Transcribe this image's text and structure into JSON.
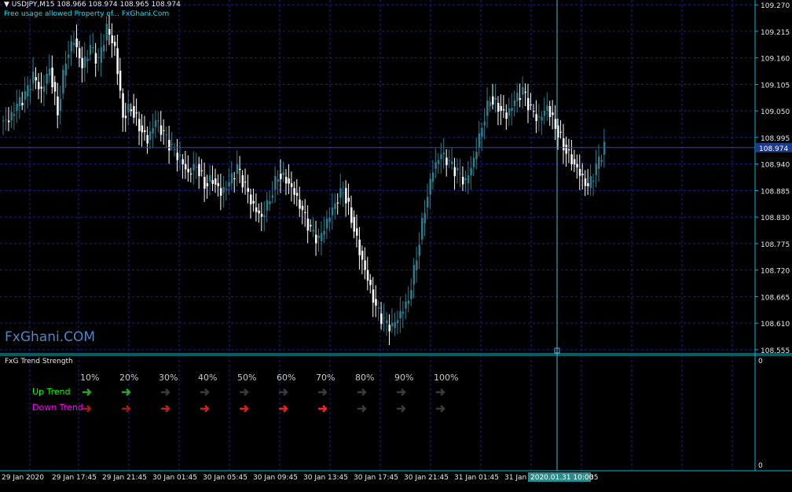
{
  "window": {
    "symbol_menu": "▼",
    "symbol_line": "USDJPY,M15  108.966 108.974 108.965 108.974",
    "notice": "Free usage allowed Property of... FxGhani.Com",
    "watermark": "FxGhani.COM",
    "current_price": "108.974",
    "crosshair_time": "2020.01.31 10:00"
  },
  "chart_data": {
    "type": "candlestick",
    "ylim": [
      108.55,
      109.28
    ],
    "y_ticks": [
      "109.270",
      "109.215",
      "109.160",
      "109.105",
      "109.050",
      "108.995",
      "108.940",
      "108.885",
      "108.830",
      "108.775",
      "108.720",
      "108.665",
      "108.610",
      "108.555"
    ],
    "x_ticks": [
      "29 Jan 2020",
      "29 Jan 17:45",
      "29 Jan 21:45",
      "30 Jan 01:45",
      "30 Jan 05:45",
      "30 Jan 09:45",
      "30 Jan 13:45",
      "30 Jan 17:45",
      "30 Jan 21:45",
      "31 Jan 01:45",
      "31 Jan",
      "35"
    ],
    "close_path": [
      109.03,
      109.06,
      109.08,
      109.12,
      109.09,
      109.14,
      109.05,
      109.16,
      109.2,
      109.14,
      109.18,
      109.15,
      109.22,
      109.18,
      109.04,
      109.06,
      109.02,
      108.99,
      109.03,
      109.0,
      108.97,
      108.95,
      108.92,
      108.94,
      108.9,
      108.91,
      108.88,
      108.9,
      108.93,
      108.89,
      108.85,
      108.83,
      108.87,
      108.92,
      108.91,
      108.88,
      108.84,
      108.8,
      108.78,
      108.82,
      108.86,
      108.89,
      108.83,
      108.76,
      108.7,
      108.64,
      108.61,
      108.6,
      108.63,
      108.66,
      108.75,
      108.85,
      108.93,
      108.96,
      108.94,
      108.92,
      108.9,
      108.95,
      109.02,
      109.08,
      109.06,
      109.04,
      109.07,
      109.09,
      109.05,
      109.03,
      109.06,
      109.02,
      108.98,
      108.95,
      108.92,
      108.89,
      108.93,
      108.974
    ],
    "last_price": 108.974,
    "ylabel": ""
  },
  "panel": {
    "title": "FxG Trend Strength",
    "scale_top": "0",
    "scale_bottom": "0",
    "percents": [
      "10%",
      "20%",
      "30%",
      "40%",
      "50%",
      "60%",
      "70%",
      "80%",
      "90%",
      "100%"
    ],
    "up_label": "Up Trend",
    "down_label": "Down Trend",
    "up_colors": [
      "#2ca02c",
      "#2ca02c",
      "#3a3a3a",
      "#3a3a3a",
      "#3a3a3a",
      "#3a3a3a",
      "#3a3a3a",
      "#3a3a3a",
      "#3a3a3a",
      "#3a3a3a"
    ],
    "down_colors": [
      "#a01a1a",
      "#a01a1a",
      "#c02020",
      "#d02020",
      "#e02020",
      "#f02020",
      "#ff2020",
      "#3a3a3a",
      "#3a3a3a",
      "#3a3a3a"
    ]
  },
  "colors": {
    "grid": "#1a237e",
    "axis": "#00bcd4",
    "up_text": "#00ff00",
    "down_text": "#ff00ff",
    "price_box": "#1e3a8a"
  }
}
